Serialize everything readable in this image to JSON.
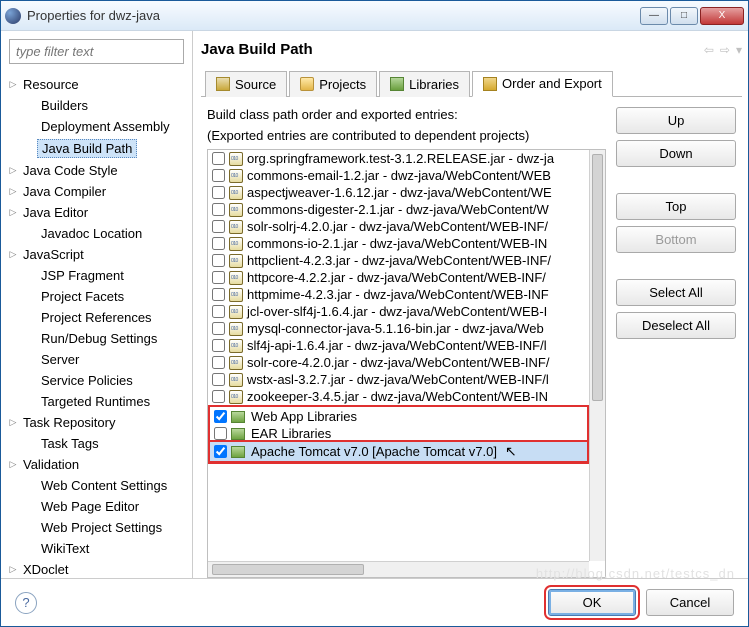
{
  "window": {
    "title": "Properties for dwz-java",
    "min": "—",
    "max": "□",
    "close": "X"
  },
  "filter_placeholder": "type filter text",
  "tree": [
    {
      "label": "Resource",
      "depth": 0,
      "expand": true
    },
    {
      "label": "Builders",
      "depth": 1
    },
    {
      "label": "Deployment Assembly",
      "depth": 1
    },
    {
      "label": "Java Build Path",
      "depth": 1,
      "selected": true
    },
    {
      "label": "Java Code Style",
      "depth": 0,
      "expand": true
    },
    {
      "label": "Java Compiler",
      "depth": 0,
      "expand": true
    },
    {
      "label": "Java Editor",
      "depth": 0,
      "expand": true
    },
    {
      "label": "Javadoc Location",
      "depth": 1
    },
    {
      "label": "JavaScript",
      "depth": 0,
      "expand": true
    },
    {
      "label": "JSP Fragment",
      "depth": 1
    },
    {
      "label": "Project Facets",
      "depth": 1
    },
    {
      "label": "Project References",
      "depth": 1
    },
    {
      "label": "Run/Debug Settings",
      "depth": 1
    },
    {
      "label": "Server",
      "depth": 1
    },
    {
      "label": "Service Policies",
      "depth": 1
    },
    {
      "label": "Targeted Runtimes",
      "depth": 1
    },
    {
      "label": "Task Repository",
      "depth": 0,
      "expand": true
    },
    {
      "label": "Task Tags",
      "depth": 1
    },
    {
      "label": "Validation",
      "depth": 0,
      "expand": true
    },
    {
      "label": "Web Content Settings",
      "depth": 1
    },
    {
      "label": "Web Page Editor",
      "depth": 1
    },
    {
      "label": "Web Project Settings",
      "depth": 1
    },
    {
      "label": "WikiText",
      "depth": 1
    },
    {
      "label": "XDoclet",
      "depth": 0,
      "expand": true
    }
  ],
  "heading": "Java Build Path",
  "tabs": [
    {
      "label": "Source",
      "icon": "source"
    },
    {
      "label": "Projects",
      "icon": "folder"
    },
    {
      "label": "Libraries",
      "icon": "lib"
    },
    {
      "label": "Order and Export",
      "icon": "order",
      "active": true
    }
  ],
  "desc1": "Build class path order and exported entries:",
  "desc2": "(Exported entries are contributed to dependent projects)",
  "entries": [
    {
      "checked": false,
      "kind": "jar",
      "label": "org.springframework.test-3.1.2.RELEASE.jar - dwz-ja"
    },
    {
      "checked": false,
      "kind": "jar",
      "label": "commons-email-1.2.jar - dwz-java/WebContent/WEB"
    },
    {
      "checked": false,
      "kind": "jar",
      "label": "aspectjweaver-1.6.12.jar - dwz-java/WebContent/WE"
    },
    {
      "checked": false,
      "kind": "jar",
      "label": "commons-digester-2.1.jar - dwz-java/WebContent/W"
    },
    {
      "checked": false,
      "kind": "jar",
      "label": "solr-solrj-4.2.0.jar - dwz-java/WebContent/WEB-INF/"
    },
    {
      "checked": false,
      "kind": "jar",
      "label": "commons-io-2.1.jar - dwz-java/WebContent/WEB-IN"
    },
    {
      "checked": false,
      "kind": "jar",
      "label": "httpclient-4.2.3.jar - dwz-java/WebContent/WEB-INF/"
    },
    {
      "checked": false,
      "kind": "jar",
      "label": "httpcore-4.2.2.jar - dwz-java/WebContent/WEB-INF/"
    },
    {
      "checked": false,
      "kind": "jar",
      "label": "httpmime-4.2.3.jar - dwz-java/WebContent/WEB-INF"
    },
    {
      "checked": false,
      "kind": "jar",
      "label": "jcl-over-slf4j-1.6.4.jar - dwz-java/WebContent/WEB-I"
    },
    {
      "checked": false,
      "kind": "jar",
      "label": "mysql-connector-java-5.1.16-bin.jar - dwz-java/Web"
    },
    {
      "checked": false,
      "kind": "jar",
      "label": "slf4j-api-1.6.4.jar - dwz-java/WebContent/WEB-INF/l"
    },
    {
      "checked": false,
      "kind": "jar",
      "label": "solr-core-4.2.0.jar - dwz-java/WebContent/WEB-INF/"
    },
    {
      "checked": false,
      "kind": "jar",
      "label": "wstx-asl-3.2.7.jar - dwz-java/WebContent/WEB-INF/l"
    },
    {
      "checked": false,
      "kind": "jar",
      "label": "zookeeper-3.4.5.jar - dwz-java/WebContent/WEB-IN"
    },
    {
      "checked": true,
      "kind": "lib",
      "label": "Web App Libraries"
    },
    {
      "checked": false,
      "kind": "lib",
      "label": "EAR Libraries"
    },
    {
      "checked": true,
      "kind": "lib",
      "label": "Apache Tomcat v7.0 [Apache Tomcat v7.0]",
      "selected": true
    }
  ],
  "buttons": {
    "up": "Up",
    "down": "Down",
    "top": "Top",
    "bottom": "Bottom",
    "select_all": "Select All",
    "deselect_all": "Deselect All"
  },
  "footer": {
    "ok": "OK",
    "cancel": "Cancel"
  },
  "watermark": "http://blog.csdn.net/testcs_dn"
}
